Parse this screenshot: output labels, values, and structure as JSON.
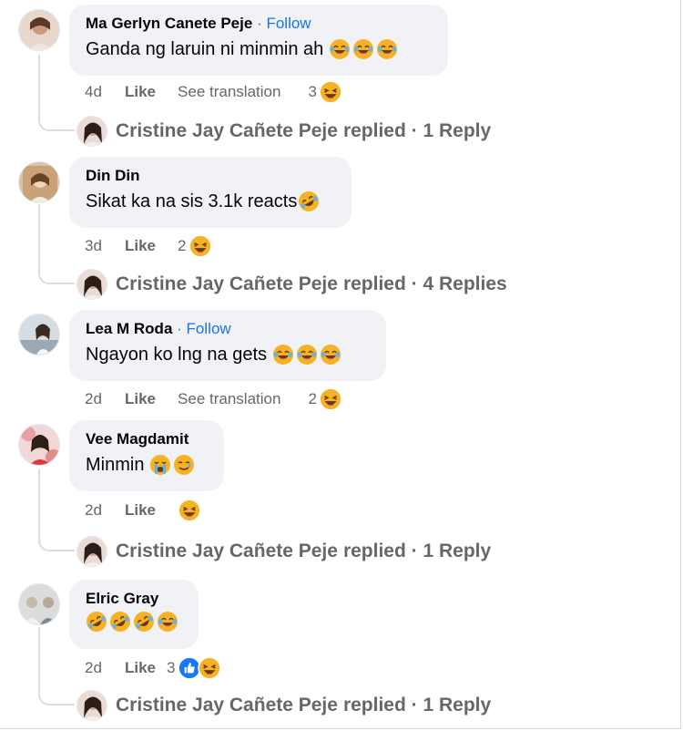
{
  "comments": [
    {
      "author": "Ma Gerlyn Canete Peje",
      "separator": "·",
      "follow": "Follow",
      "text": "Ganda ng laruin ni minmin ah",
      "emojis": [
        "laugh-cry-emoji",
        "laugh-cry-emoji",
        "laugh-cry-emoji"
      ],
      "time": "4d",
      "like": "Like",
      "translation": "See translation",
      "reaction_count": "3",
      "reply_author": "Cristine Jay Cañete Peje",
      "reply_summary": "replied · 1 Reply"
    },
    {
      "author": "Din Din",
      "text": "Sikat ka na sis 3.1k reacts",
      "emojis": [
        "rolling-laugh-emoji"
      ],
      "time": "3d",
      "like": "Like",
      "reaction_count": "2",
      "reply_author": "Cristine Jay Cañete Peje",
      "reply_summary": "replied · 4 Replies"
    },
    {
      "author": "Lea M Roda",
      "separator": "·",
      "follow": "Follow",
      "text": "Ngayon ko lng na gets",
      "emojis": [
        "laugh-cry-emoji",
        "laugh-cry-emoji",
        "laugh-cry-emoji"
      ],
      "time": "2d",
      "like": "Like",
      "translation": "See translation",
      "reaction_count": "2"
    },
    {
      "author": "Vee Magdamit",
      "text": "Minmin",
      "emojis": [
        "crying-emoji",
        "smiling-tear-emoji"
      ],
      "time": "2d",
      "like": "Like",
      "reply_author": "Cristine Jay Cañete Peje",
      "reply_summary": "replied · 1 Reply"
    },
    {
      "author": "Elric Gray",
      "text": "",
      "emojis": [
        "rolling-laugh-emoji",
        "rolling-laugh-emoji",
        "rolling-laugh-emoji",
        "laugh-cry-emoji"
      ],
      "time": "2d",
      "like": "Like",
      "reaction_count": "3",
      "reply_author": "Cristine Jay Cañete Peje",
      "reply_summary": "replied · 1 Reply"
    }
  ],
  "icons": {
    "haha_reaction": "haha-reaction-icon",
    "like_reaction": "like-reaction-icon"
  },
  "colors": {
    "bubble": "#f0f2f5",
    "follow": "#1b74e4",
    "meta": "#65676b",
    "like_blue": "#1877f2",
    "emoji_yellow": "#f7b125"
  }
}
